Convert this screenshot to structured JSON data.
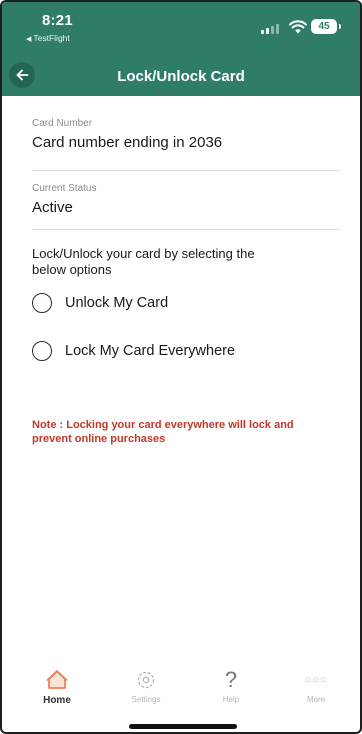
{
  "status_bar": {
    "time": "8:21",
    "back_app": "TestFlight",
    "battery": "45"
  },
  "header": {
    "title": "Lock/Unlock Card",
    "back_icon": "arrow-left-icon"
  },
  "card": {
    "number_label": "Card Number",
    "number_value": "Card number ending in 2036",
    "status_label": "Current Status",
    "status_value": "Active"
  },
  "instructions": "Lock/Unlock your card by selecting the below options",
  "options": [
    {
      "label": "Unlock My Card",
      "selected": false
    },
    {
      "label": "Lock My Card Everywhere",
      "selected": false
    }
  ],
  "note": "Note : Locking your card everywhere will lock and prevent online purchases",
  "tabs": [
    {
      "label": "Home",
      "icon": "home-icon",
      "active": true
    },
    {
      "label": "Settings",
      "icon": "gear-icon",
      "active": false
    },
    {
      "label": "Help",
      "icon": "help-icon",
      "active": false
    },
    {
      "label": "More",
      "icon": "more-icon",
      "active": false
    }
  ],
  "colors": {
    "brand": "#2f7d69",
    "note": "#c0392b",
    "home_icon": "#e9835a"
  }
}
